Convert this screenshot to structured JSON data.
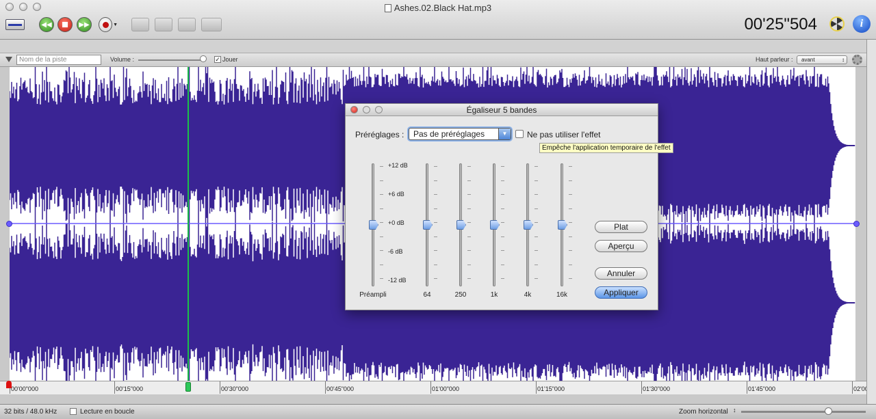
{
  "window": {
    "title": "Ashes.02.Black Hat.mp3",
    "time": "00'25\"504"
  },
  "toolbar": {
    "buttons": [
      {
        "name": "rewind-button",
        "icon": "rewind-icon"
      },
      {
        "name": "stop-button",
        "icon": "stop-icon"
      },
      {
        "name": "fast-forward-button",
        "icon": "fast-forward-icon"
      },
      {
        "name": "record-button",
        "icon": "record-icon"
      }
    ]
  },
  "track": {
    "name_placeholder": "Nom de la piste",
    "volume_label": "Volume :",
    "volume_level": 0.97,
    "play_label": "Jouer",
    "play_checked": true,
    "speaker_label": "Haut parleur :",
    "speaker_value": "avant"
  },
  "ruler": {
    "ticks": [
      "00'00\"000",
      "00'15\"000",
      "00'30\"000",
      "00'45\"000",
      "01'00\"000",
      "01'15\"000",
      "01'30\"000",
      "01'45\"000",
      "02'00\""
    ]
  },
  "status": {
    "format": "32 bits / 48.0 kHz",
    "loop_label": "Lecture en boucle",
    "zoom_label": "Zoom horizontal",
    "zoom_level": 0.7
  },
  "dialog": {
    "title": "Égaliseur 5 bandes",
    "presets_label": "Préréglages :",
    "preset_value": "Pas de préréglages",
    "bypass_label": "Ne pas utiliser l'effet",
    "tooltip": "Empêche l'application temporaire de l'effet",
    "scale": [
      "+12 dB",
      "+6 dB",
      "+0 dB",
      "-6 dB",
      "-12 dB"
    ],
    "bands": [
      "Préampli",
      "64",
      "250",
      "1k",
      "4k",
      "16k"
    ],
    "band_gains_db": [
      0,
      0,
      0,
      0,
      0,
      0
    ],
    "buttons": {
      "flat": "Plat",
      "preview": "Aperçu",
      "cancel": "Annuler",
      "apply": "Appliquer"
    }
  },
  "colors": {
    "waveform": "#3a2494",
    "playhead": "#1cbf4a",
    "envelope": "#6b5cff"
  }
}
